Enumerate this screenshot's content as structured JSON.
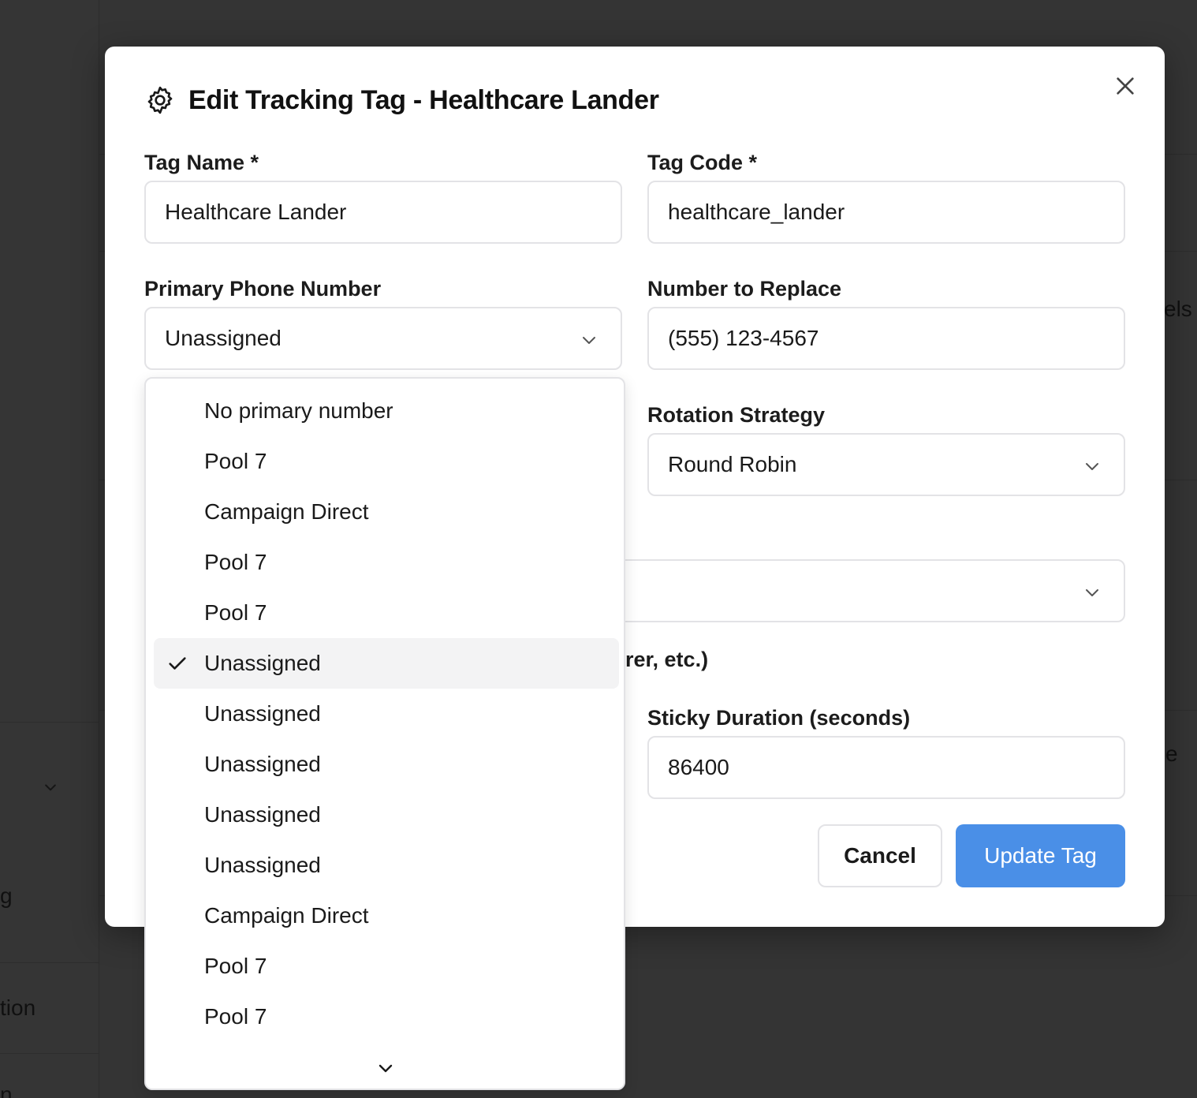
{
  "background": {
    "fragments": {
      "els": "els",
      "e": "e",
      "g": "g",
      "tion": "tion",
      "n": "n"
    }
  },
  "modal": {
    "title": "Edit Tracking Tag - Healthcare Lander",
    "fields": {
      "tag_name": {
        "label": "Tag Name *",
        "value": "Healthcare Lander"
      },
      "tag_code": {
        "label": "Tag Code *",
        "value": "healthcare_lander"
      },
      "primary_phone": {
        "label": "Primary Phone Number",
        "value": "Unassigned"
      },
      "number_to_replace": {
        "label": "Number to Replace",
        "value": "(555) 123-4567"
      },
      "rotation_strategy": {
        "label": "Rotation Strategy",
        "value": "Round Robin"
      },
      "hidden_select": {
        "value": ""
      },
      "help_text_fragment": "rer, etc.)",
      "sticky_duration": {
        "label": "Sticky Duration (seconds)",
        "value": "86400"
      }
    },
    "buttons": {
      "cancel": "Cancel",
      "update": "Update Tag"
    }
  },
  "dropdown": {
    "options": [
      "No primary number",
      "Pool 7",
      "Campaign Direct",
      "Pool 7",
      "Pool 7",
      "Unassigned",
      "Unassigned",
      "Unassigned",
      "Unassigned",
      "Unassigned",
      "Campaign Direct",
      "Pool 7",
      "Pool 7"
    ],
    "selected_index": 5
  },
  "colors": {
    "primary": "#4a8fe7",
    "overlay": "#333333",
    "selected_bg": "#f3f3f4"
  }
}
